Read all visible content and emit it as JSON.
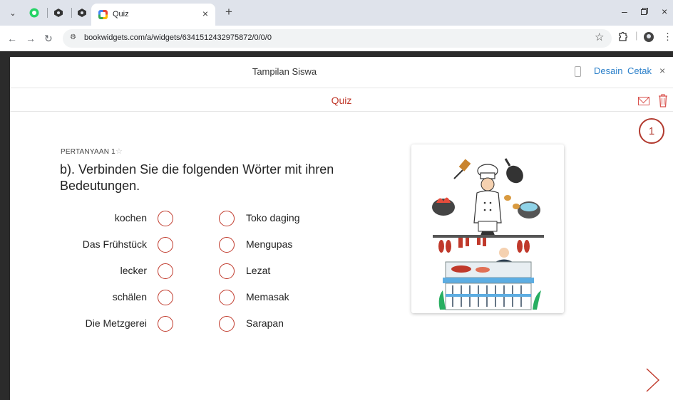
{
  "browser": {
    "tab_title": "Quiz",
    "url": "bookwidgets.com/a/widgets/6341512432975872/0/0/0"
  },
  "modal": {
    "title": "Tampilan Siswa",
    "desain_label": "Desain",
    "cetak_label": "Cetak"
  },
  "quiz": {
    "title": "Quiz",
    "counter": "1",
    "question_label": "PERTANYAAN 1",
    "question_text": "b). Verbinden Sie die folgenden Wörter mit ihren Bedeutungen.",
    "left_items": [
      "kochen",
      "Das Frühstück",
      "lecker",
      "schälen",
      "Die Metzgerei"
    ],
    "right_items": [
      "Toko daging",
      "Mengupas",
      "Lezat",
      "Memasak",
      "Sarapan"
    ]
  },
  "colors": {
    "accent": "#c0392b",
    "link": "#2a7fc9"
  }
}
